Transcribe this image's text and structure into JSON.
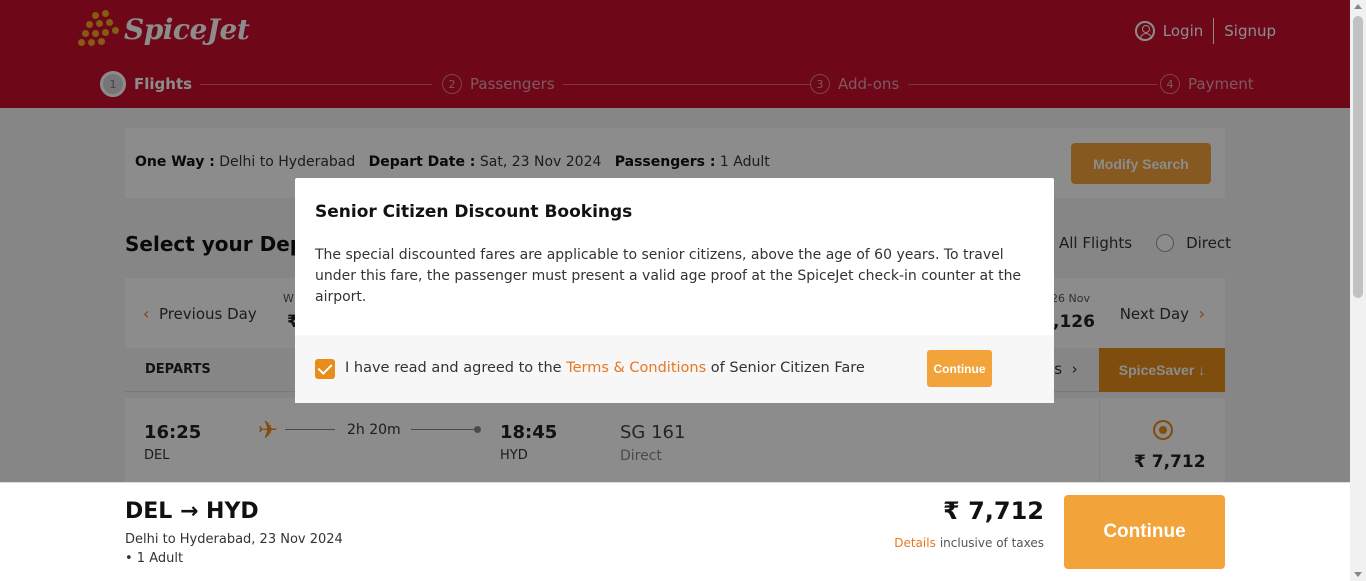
{
  "brand": {
    "name": "SpiceJet",
    "accent": "#c8102e",
    "button_color": "#f2a33a"
  },
  "auth": {
    "icon": "user-circle-icon",
    "login": "Login",
    "signup": "Signup"
  },
  "steps": [
    {
      "num": "1",
      "label": "Flights",
      "active": true
    },
    {
      "num": "2",
      "label": "Passengers"
    },
    {
      "num": "3",
      "label": "Add-ons"
    },
    {
      "num": "4",
      "label": "Payment"
    }
  ],
  "search": {
    "trip_label": "One Way :",
    "trip_value": "Delhi to Hyderabad",
    "date_label": "Depart Date :",
    "date_value": "Sat, 23 Nov 2024",
    "pax_label": "Passengers :",
    "pax_value": "1 Adult",
    "modify_button": "Modify Search"
  },
  "select_title": "Select your Depa",
  "filters": {
    "all": "All Flights",
    "direct": "Direct"
  },
  "date_strip": {
    "prev": "Previous Day",
    "next": "Next Day",
    "left_fragment_top": "W",
    "left_fragment_bottom": "₹",
    "right_fragment_top": "26 Nov",
    "right_fragment_bottom": ",126"
  },
  "table": {
    "departs": "DEPARTS",
    "fare_fragment": "es",
    "spicesaver": "SpiceSaver"
  },
  "flight": {
    "dep_time": "16:25",
    "dep_code": "DEL",
    "duration": "2h 20m",
    "arr_time": "18:45",
    "arr_code": "HYD",
    "flight_no": "SG 161",
    "stops": "Direct",
    "price": "₹ 7,712"
  },
  "modal": {
    "title": "Senior Citizen Discount Bookings",
    "body": "The special discounted fares are applicable to senior citizens, above the age of 60 years. To travel under this fare, the passenger must present a valid age proof at the SpiceJet check-in counter at the airport.",
    "agree_prefix": "I have read and agreed to the",
    "terms_link": "Terms & Conditions",
    "agree_suffix": "of Senior Citizen Fare",
    "checked": true,
    "continue": "Continue"
  },
  "bottom": {
    "route": "DEL → HYD",
    "route_sub": "Delhi to Hyderabad, 23 Nov 2024",
    "pax": "• 1 Adult",
    "price": "₹ 7,712",
    "details": "Details",
    "tax_note": "inclusive of taxes",
    "continue": "Continue"
  }
}
